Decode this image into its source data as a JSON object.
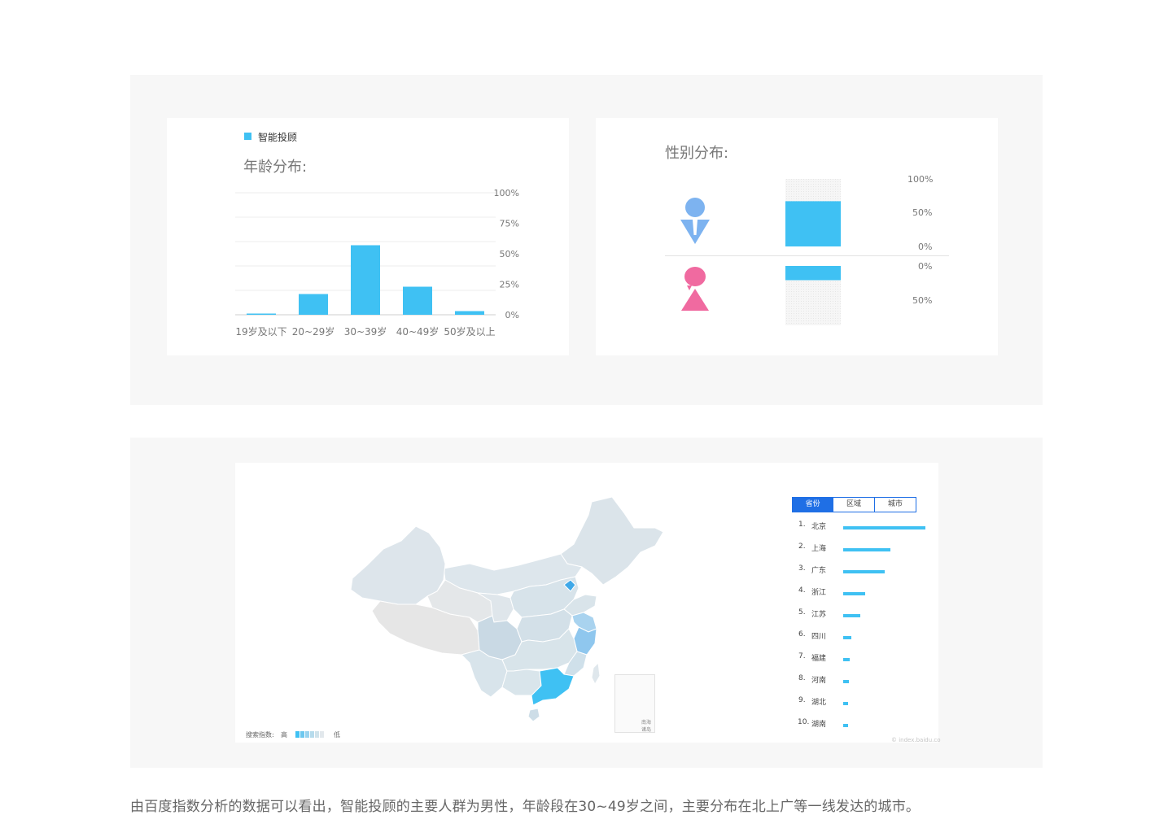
{
  "age_card": {
    "legend": "智能投顾",
    "title": "年龄分布:"
  },
  "gender_card": {
    "title": "性别分布:",
    "male_ticks": [
      "100%",
      "50%",
      "0%"
    ],
    "female_ticks": [
      "0%",
      "50%"
    ]
  },
  "map_card": {
    "tabs": [
      "省份",
      "区域",
      "城市"
    ],
    "active_tab": 0,
    "legend_label": "搜索指数:",
    "legend_high": "高",
    "legend_low": "低",
    "inset_label": "南海诸岛",
    "watermark": "© index.baidu.co",
    "ranking": [
      {
        "num": "1.",
        "name": "北京",
        "value": 100
      },
      {
        "num": "2.",
        "name": "上海",
        "value": 57
      },
      {
        "num": "3.",
        "name": "广东",
        "value": 50
      },
      {
        "num": "4.",
        "name": "浙江",
        "value": 27
      },
      {
        "num": "5.",
        "name": "江苏",
        "value": 21
      },
      {
        "num": "6.",
        "name": "四川",
        "value": 10
      },
      {
        "num": "7.",
        "name": "福建",
        "value": 8
      },
      {
        "num": "8.",
        "name": "河南",
        "value": 7
      },
      {
        "num": "9.",
        "name": "湖北",
        "value": 6
      },
      {
        "num": "10.",
        "name": "湖南",
        "value": 6
      }
    ]
  },
  "caption": "由百度指数分析的数据可以看出，智能投顾的主要人群为男性，年龄段在30~49岁之间，主要分布在北上广等一线发达的城市。",
  "colors": {
    "bar": "#3fc1f3",
    "male": "#7db3f0",
    "female": "#f06aa0",
    "tab_active": "#1f6fe5"
  },
  "chart_data": [
    {
      "type": "bar",
      "title": "年龄分布:",
      "categories": [
        "19岁及以下",
        "20~29岁",
        "30~39岁",
        "40~49岁",
        "50岁及以上"
      ],
      "series": [
        {
          "name": "智能投顾",
          "values": [
            1,
            17,
            57,
            23,
            3
          ]
        }
      ],
      "ylim": [
        0,
        100
      ],
      "yticks": [
        "100%",
        "75%",
        "50%",
        "25%",
        "0%"
      ],
      "grid": true,
      "legend": "top-left"
    },
    {
      "type": "bar",
      "title": "性别分布:",
      "categories": [
        "男",
        "女"
      ],
      "values": [
        67,
        33
      ],
      "ylim": [
        0,
        100
      ]
    }
  ]
}
